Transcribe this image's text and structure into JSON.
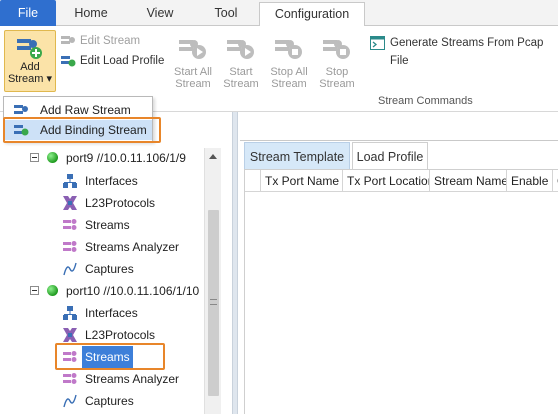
{
  "menu_tabs": {
    "file": "File",
    "home": "Home",
    "view": "View",
    "tool": "Tool",
    "configuration": "Configuration"
  },
  "ribbon": {
    "add_stream": {
      "line1": "Add",
      "line2": "Stream ▾",
      "icon": "add-stream-icon"
    },
    "edit_stream": "Edit Stream",
    "edit_load_profile": "Edit Load Profile",
    "start_all": {
      "line1": "Start All",
      "line2": "Stream"
    },
    "start": {
      "line1": "Start",
      "line2": "Stream"
    },
    "stop_all": {
      "line1": "Stop All",
      "line2": "Stream"
    },
    "stop": {
      "line1": "Stop",
      "line2": "Stream"
    },
    "generate_pcap": "Generate Streams From Pcap File",
    "group_label": "Stream Commands"
  },
  "dropdown": {
    "items": [
      "Add Raw Stream",
      "Add Binding Stream"
    ],
    "highlighted": "Add Binding Stream"
  },
  "tree": {
    "port9": {
      "label": "port9 //10.0.11.106/1/9",
      "children": [
        "Interfaces",
        "L23Protocols",
        "Streams",
        "Streams Analyzer",
        "Captures"
      ]
    },
    "port10": {
      "label": "port10 //10.0.11.106/1/10",
      "children": [
        "Interfaces",
        "L23Protocols",
        "Streams",
        "Streams Analyzer",
        "Captures"
      ],
      "selected": "Streams"
    }
  },
  "right_tabs": [
    "Stream Template",
    "Load Profile"
  ],
  "grid_headers": [
    "Tx Port Name",
    "Tx Port Location",
    "Stream Name",
    "Enable",
    "C"
  ],
  "colors": {
    "accent": "#2f6fcf",
    "highlight": "#e8862a",
    "selection": "#3d7fd9",
    "status_ok": "#1f9a1f"
  }
}
